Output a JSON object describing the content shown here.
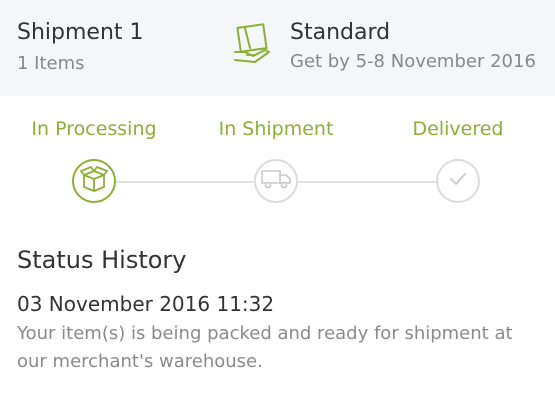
{
  "shipment": {
    "title": "Shipment 1",
    "items": "1 Items",
    "method": "Standard",
    "eta": "Get by 5-8 November 2016"
  },
  "steps": [
    {
      "label": "In Processing",
      "icon": "box-icon",
      "state": "active"
    },
    {
      "label": "In Shipment",
      "icon": "truck-icon",
      "state": "inactive"
    },
    {
      "label": "Delivered",
      "icon": "check-icon",
      "state": "inactive"
    }
  ],
  "history": {
    "title": "Status History",
    "entries": [
      {
        "time": "03 November 2016 11:32",
        "text": "Your item(s) is being packed and ready for shipment at our merchant's warehouse."
      }
    ]
  },
  "colors": {
    "accent": "#8ab034",
    "inactive": "#dcdcdc",
    "header_bg": "#f5f6f7"
  }
}
